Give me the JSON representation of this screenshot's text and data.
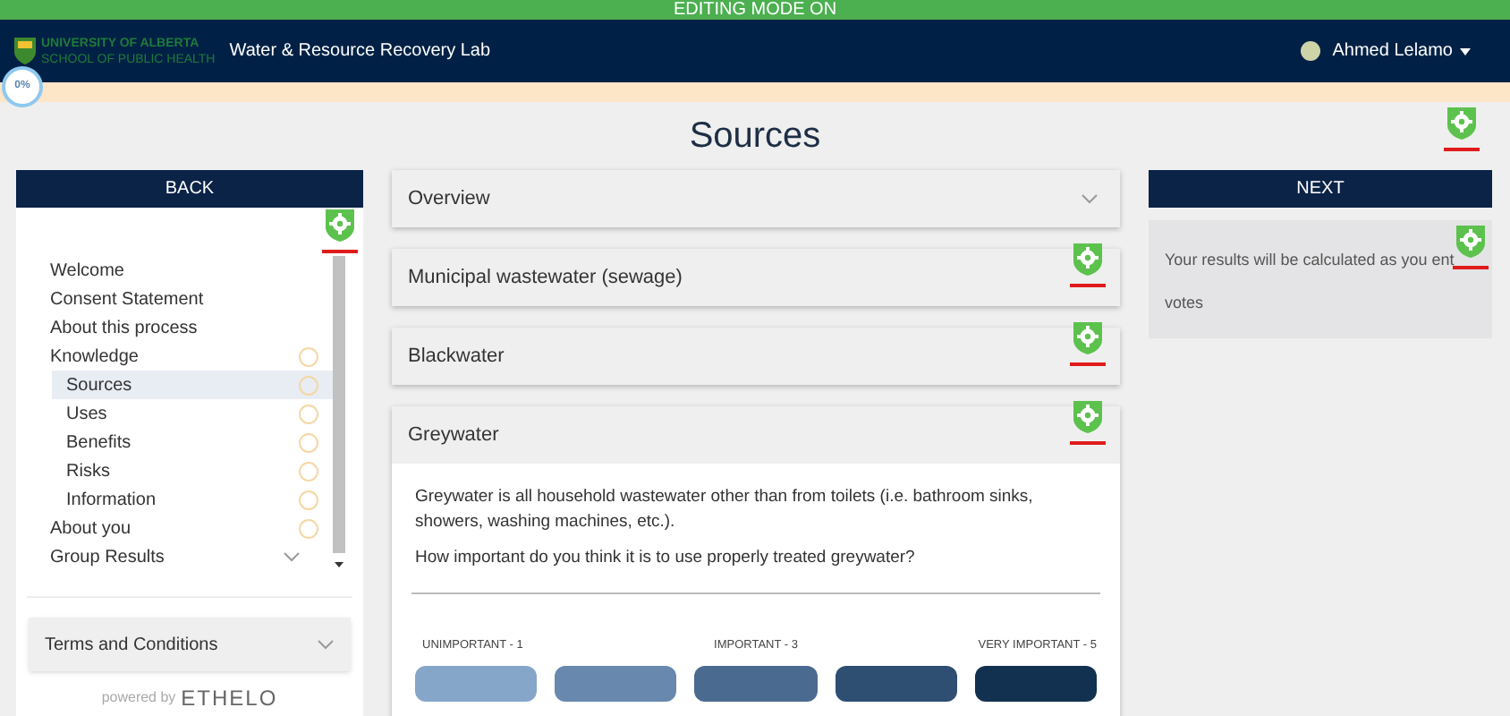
{
  "banner": "EDITING MODE ON",
  "header": {
    "org_line_1": "UNIVERSITY OF ALBERTA",
    "org_line_2": "SCHOOL OF PUBLIC HEALTH",
    "project": "Water & Resource Recovery Lab",
    "user": "Ahmed Lelamo"
  },
  "progress": {
    "label": "0%",
    "level": 0
  },
  "page": {
    "title": "Sources",
    "edit_badge": true
  },
  "back_button": "BACK",
  "next_button": "NEXT",
  "sidebar": {
    "edit_badge": true,
    "items": [
      {
        "label": "Welcome",
        "tracked": false,
        "selected": false
      },
      {
        "label": "Consent Statement",
        "tracked": false,
        "selected": false
      },
      {
        "label": "About this process",
        "tracked": false,
        "selected": false
      },
      {
        "label": "Knowledge",
        "tracked": true,
        "selected": false,
        "children": [
          {
            "label": "Sources",
            "tracked": true,
            "selected": true
          },
          {
            "label": "Uses",
            "tracked": true,
            "selected": false
          },
          {
            "label": "Benefits",
            "tracked": true,
            "selected": false
          },
          {
            "label": "Risks",
            "tracked": true,
            "selected": false
          },
          {
            "label": "Information",
            "tracked": true,
            "selected": false
          }
        ]
      },
      {
        "label": "About you",
        "tracked": true,
        "selected": false
      },
      {
        "label": "Group Results",
        "tracked": false,
        "selected": false,
        "expandable": true
      }
    ],
    "terms": {
      "label": "Terms and Conditions",
      "expanded": false
    },
    "powered_by": "powered by",
    "brand": "ETHELO"
  },
  "accordions": [
    {
      "title": "Overview",
      "expanded": false,
      "edit_badge": false
    },
    {
      "title": "Municipal wastewater (sewage)",
      "expanded": false,
      "edit_badge": true
    },
    {
      "title": "Blackwater",
      "expanded": false,
      "edit_badge": true
    },
    {
      "title": "Greywater",
      "expanded": true,
      "edit_badge": true,
      "description": "Greywater is all household wastewater other than from toilets (i.e. bathroom sinks, showers, washing machines, etc.).",
      "question": "How important do you think it is to use properly treated greywater?",
      "scale": [
        {
          "label": "UNIMPORTANT - 1",
          "color": "#86a6c9"
        },
        {
          "color": "#6888ae"
        },
        {
          "label": "IMPORTANT - 3",
          "color": "#4a6a90"
        },
        {
          "color": "#2e4e72"
        },
        {
          "label": "VERY IMPORTANT - 5",
          "color": "#12304f"
        }
      ]
    }
  ],
  "results_note": {
    "edit_badge": true,
    "lines": [
      "Your results will be calculated as you ent",
      "votes"
    ]
  }
}
